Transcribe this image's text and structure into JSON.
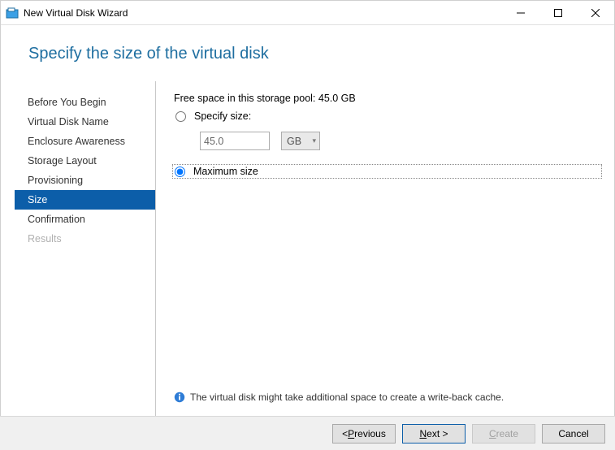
{
  "window": {
    "title": "New Virtual Disk Wizard"
  },
  "heading": "Specify the size of the virtual disk",
  "sidebar": {
    "steps": [
      {
        "label": "Before You Begin",
        "state": "done"
      },
      {
        "label": "Virtual Disk Name",
        "state": "done"
      },
      {
        "label": "Enclosure Awareness",
        "state": "done"
      },
      {
        "label": "Storage Layout",
        "state": "done"
      },
      {
        "label": "Provisioning",
        "state": "done"
      },
      {
        "label": "Size",
        "state": "active"
      },
      {
        "label": "Confirmation",
        "state": "pending"
      },
      {
        "label": "Results",
        "state": "disabled"
      }
    ]
  },
  "content": {
    "free_space_label": "Free space in this storage pool: 45.0 GB",
    "option_specify": {
      "label": "Specify size:",
      "selected": false,
      "value": "45.0",
      "unit": "GB"
    },
    "option_max": {
      "label": "Maximum size",
      "selected": true
    },
    "info_text": "The virtual disk might take additional space to create a write-back cache."
  },
  "footer": {
    "previous": "< Previous",
    "next": "Next >",
    "create": "Create",
    "cancel": "Cancel"
  }
}
